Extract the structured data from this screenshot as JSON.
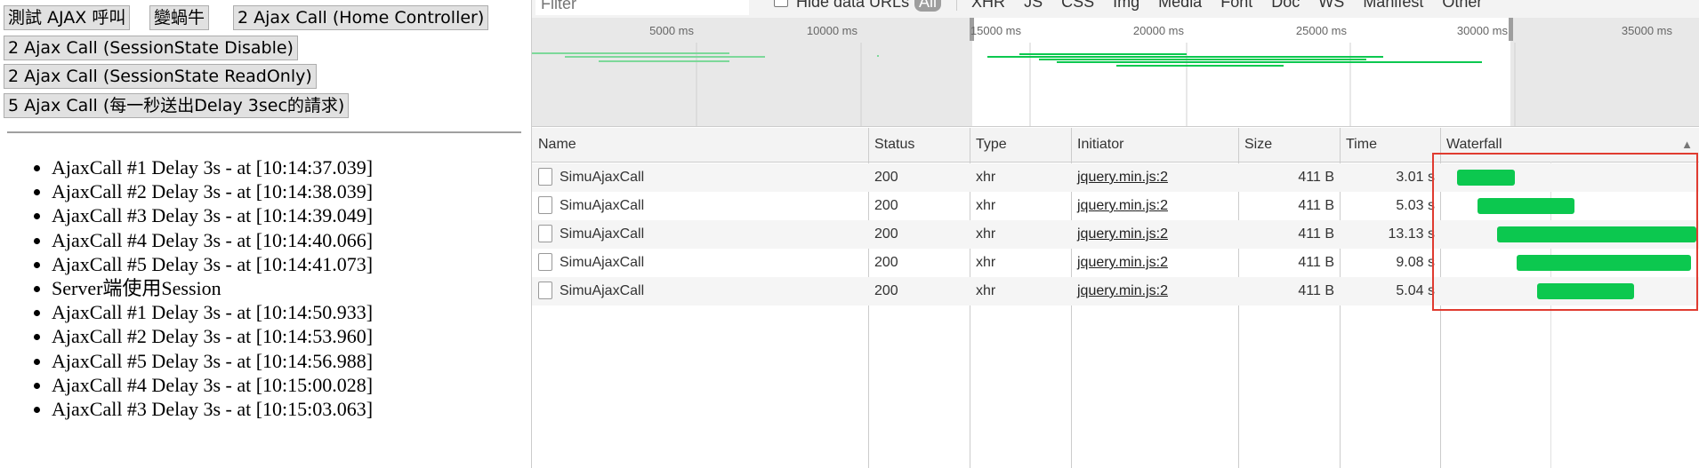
{
  "buttons": [
    {
      "label": "測試 AJAX 呼叫"
    },
    {
      "label": "變蝸牛"
    },
    {
      "label": "2 Ajax Call (Home Controller)"
    },
    {
      "label": "2 Ajax Call (SessionState Disable)"
    },
    {
      "label": "2 Ajax Call (SessionState ReadOnly)"
    },
    {
      "label": "5 Ajax Call (每一秒送出Delay 3sec的請求)"
    }
  ],
  "log": [
    "AjaxCall #1 Delay 3s - at [10:14:37.039]",
    "AjaxCall #2 Delay 3s - at [10:14:38.039]",
    "AjaxCall #3 Delay 3s - at [10:14:39.049]",
    "AjaxCall #4 Delay 3s - at [10:14:40.066]",
    "AjaxCall #5 Delay 3s - at [10:14:41.073]",
    "Server端使用Session",
    "AjaxCall #1 Delay 3s - at [10:14:50.933]",
    "AjaxCall #2 Delay 3s - at [10:14:53.960]",
    "AjaxCall #5 Delay 3s - at [10:14:56.988]",
    "AjaxCall #4 Delay 3s - at [10:15:00.028]",
    "AjaxCall #3 Delay 3s - at [10:15:03.063]"
  ],
  "devtools": {
    "filter_placeholder": "Filter",
    "hide_data_urls": "Hide data URLs",
    "types": [
      "All",
      "XHR",
      "JS",
      "CSS",
      "Img",
      "Media",
      "Font",
      "Doc",
      "WS",
      "Manifest",
      "Other"
    ],
    "active_type": "All",
    "overview_ticks": [
      "5000 ms",
      "10000 ms",
      "15000 ms",
      "20000 ms",
      "25000 ms",
      "30000 ms",
      "35000 ms"
    ],
    "columns": [
      "Name",
      "Status",
      "Type",
      "Initiator",
      "Size",
      "Time",
      "Waterfall"
    ],
    "rows": [
      {
        "name": "SimuAjaxCall",
        "status": "200",
        "type": "xhr",
        "initiator": "jquery.min.js:2",
        "size": "411 B",
        "time": "3.01 s",
        "start_frac": 0.04,
        "end_frac": 0.27
      },
      {
        "name": "SimuAjaxCall",
        "status": "200",
        "type": "xhr",
        "initiator": "jquery.min.js:2",
        "size": "411 B",
        "time": "5.03 s",
        "start_frac": 0.12,
        "end_frac": 0.51
      },
      {
        "name": "SimuAjaxCall",
        "status": "200",
        "type": "xhr",
        "initiator": "jquery.min.js:2",
        "size": "411 B",
        "time": "13.13 s",
        "start_frac": 0.2,
        "end_frac": 1.0
      },
      {
        "name": "SimuAjaxCall",
        "status": "200",
        "type": "xhr",
        "initiator": "jquery.min.js:2",
        "size": "411 B",
        "time": "9.08 s",
        "start_frac": 0.28,
        "end_frac": 0.98
      },
      {
        "name": "SimuAjaxCall",
        "status": "200",
        "type": "xhr",
        "initiator": "jquery.min.js:2",
        "size": "411 B",
        "time": "5.04 s",
        "start_frac": 0.36,
        "end_frac": 0.75
      }
    ],
    "colors": {
      "bar": "#0cc84f",
      "highlight": "#e03b30"
    }
  }
}
